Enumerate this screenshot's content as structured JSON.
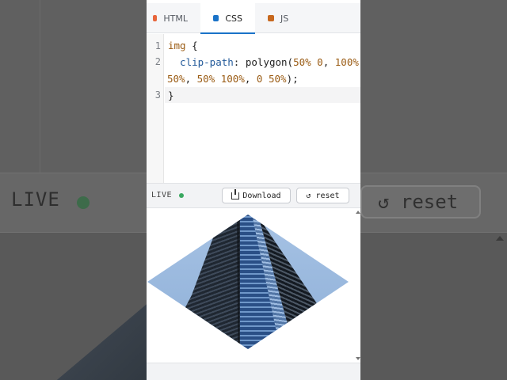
{
  "background": {
    "live_label": "LIVE",
    "reset_label": "↺ reset"
  },
  "tabs": [
    {
      "label": "HTML",
      "color": "#e8663c",
      "active": false
    },
    {
      "label": "CSS",
      "color": "#1a73c8",
      "active": true
    },
    {
      "label": "JS",
      "color": "#c7681e",
      "active": false
    }
  ],
  "editor": {
    "line_numbers": [
      "1",
      "2",
      "3"
    ],
    "lines": {
      "l1_selector": "img",
      "l1_brace": " {",
      "l2_prop": "  clip-path",
      "l2_colon": ": polygon(",
      "l2_v1": "50% 0",
      "l2_c1": ", ",
      "l2_v2": "100%",
      "l3_v1": "50%",
      "l3_c1": ", ",
      "l3_v2": "50% 100%",
      "l3_c2": ", ",
      "l3_v3": "0 50%",
      "l3_end": ");",
      "l4_brace": "}"
    }
  },
  "toolbar": {
    "live_label": "LIVE",
    "live_color": "#3aa860",
    "download_label": "Download",
    "reset_label": "↺ reset"
  }
}
